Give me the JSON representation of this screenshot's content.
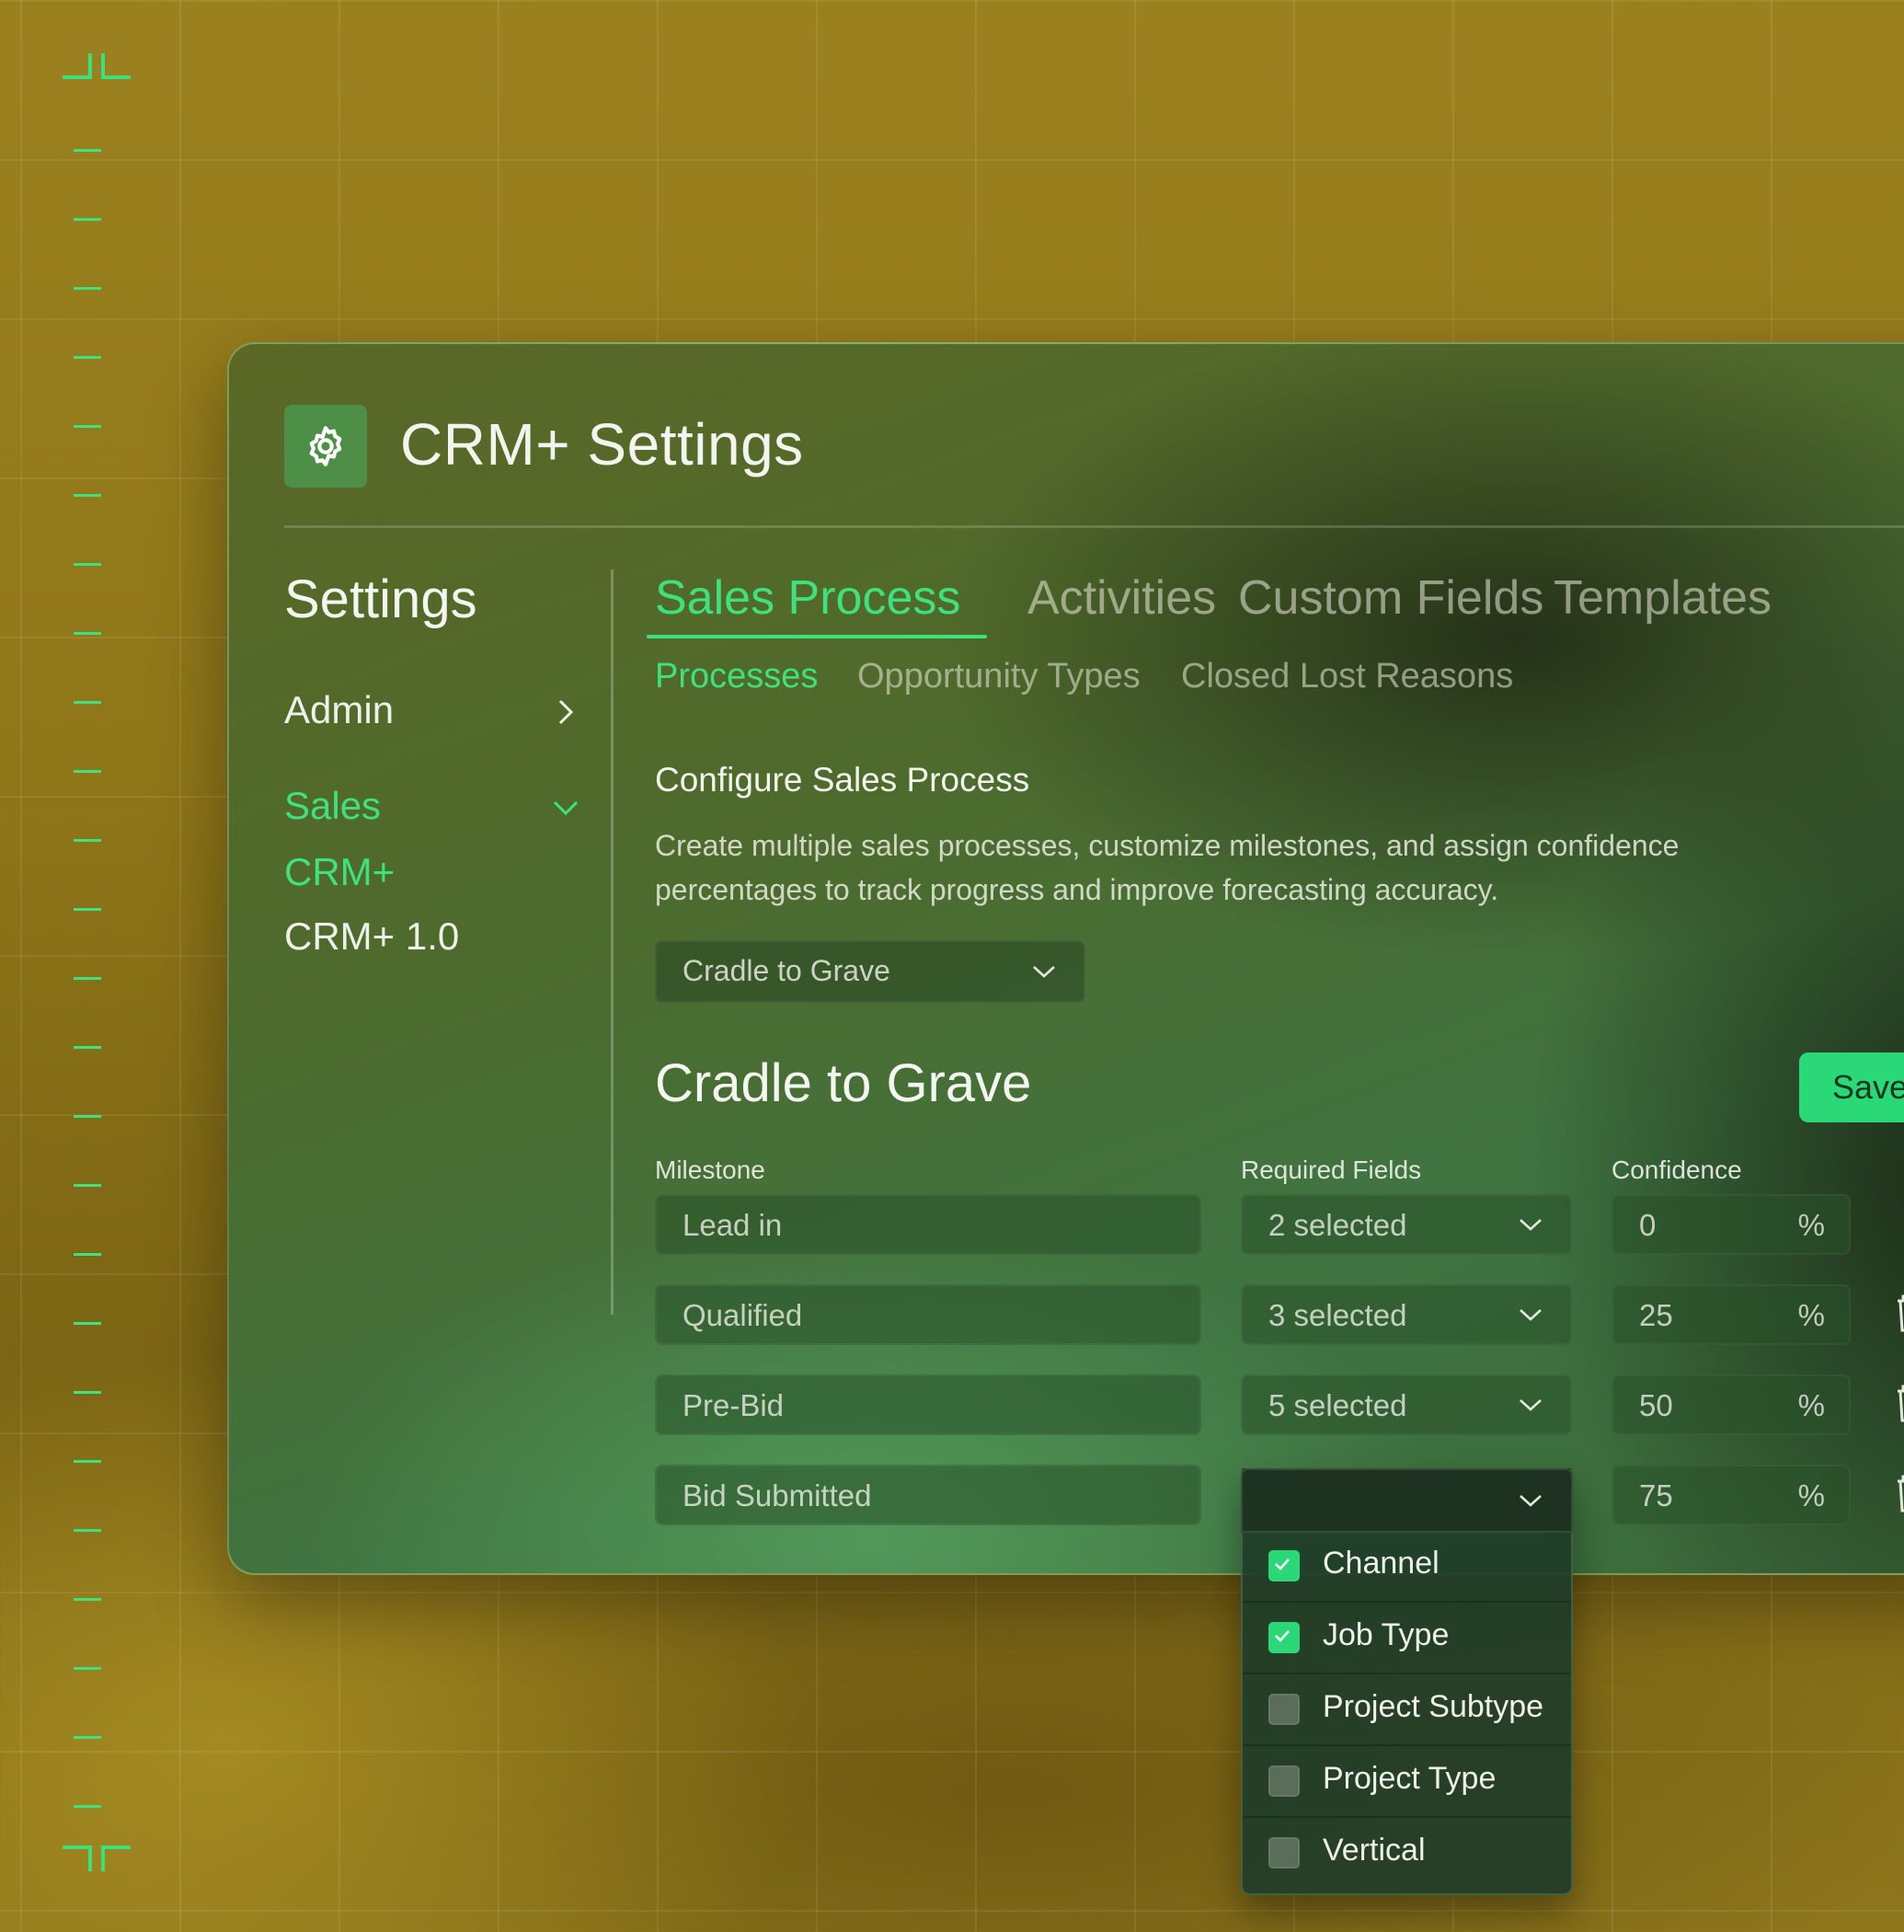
{
  "app": {
    "title": "CRM+ Settings"
  },
  "sidebar": {
    "heading": "Settings",
    "items": [
      {
        "label": "Admin"
      },
      {
        "label": "Sales"
      },
      {
        "label": "CRM+"
      },
      {
        "label": "CRM+ 1.0"
      }
    ]
  },
  "tabs": [
    {
      "label": "Sales Process",
      "active": true
    },
    {
      "label": "Activities"
    },
    {
      "label": "Custom Fields"
    },
    {
      "label": "Templates"
    }
  ],
  "subtabs": [
    {
      "label": "Processes",
      "active": true
    },
    {
      "label": "Opportunity Types"
    },
    {
      "label": "Closed Lost Reasons"
    }
  ],
  "section": {
    "title": "Configure Sales Process",
    "description": "Create multiple sales processes, customize milestones, and assign confidence percentages to track progress and improve forecasting accuracy."
  },
  "process_select": {
    "value": "Cradle to Grave"
  },
  "process": {
    "title": "Cradle to Grave",
    "save_label": "Save",
    "columns": {
      "milestone": "Milestone",
      "required": "Required Fields",
      "confidence": "Confidence"
    },
    "rows": [
      {
        "milestone": "Lead in",
        "required": "2 selected",
        "confidence": "0",
        "unit": "%"
      },
      {
        "milestone": "Qualified",
        "required": "3 selected",
        "confidence": "25",
        "unit": "%"
      },
      {
        "milestone": "Pre-Bid",
        "required": "5 selected",
        "confidence": "50",
        "unit": "%"
      },
      {
        "milestone": "Bid Submitted",
        "required": "",
        "confidence": "75",
        "unit": "%"
      }
    ]
  },
  "dropdown": {
    "options": [
      {
        "label": "Channel",
        "checked": true
      },
      {
        "label": "Job Type",
        "checked": true
      },
      {
        "label": "Project Subtype",
        "checked": false
      },
      {
        "label": "Project Type",
        "checked": false
      },
      {
        "label": "Vertical",
        "checked": false
      }
    ]
  },
  "colors": {
    "accent": "#3de27e",
    "button": "#2bd877",
    "background": "#8f7619"
  },
  "icons": [
    "gear-icon",
    "chevron-right-icon",
    "chevron-down-icon",
    "trash-icon",
    "check-icon"
  ]
}
